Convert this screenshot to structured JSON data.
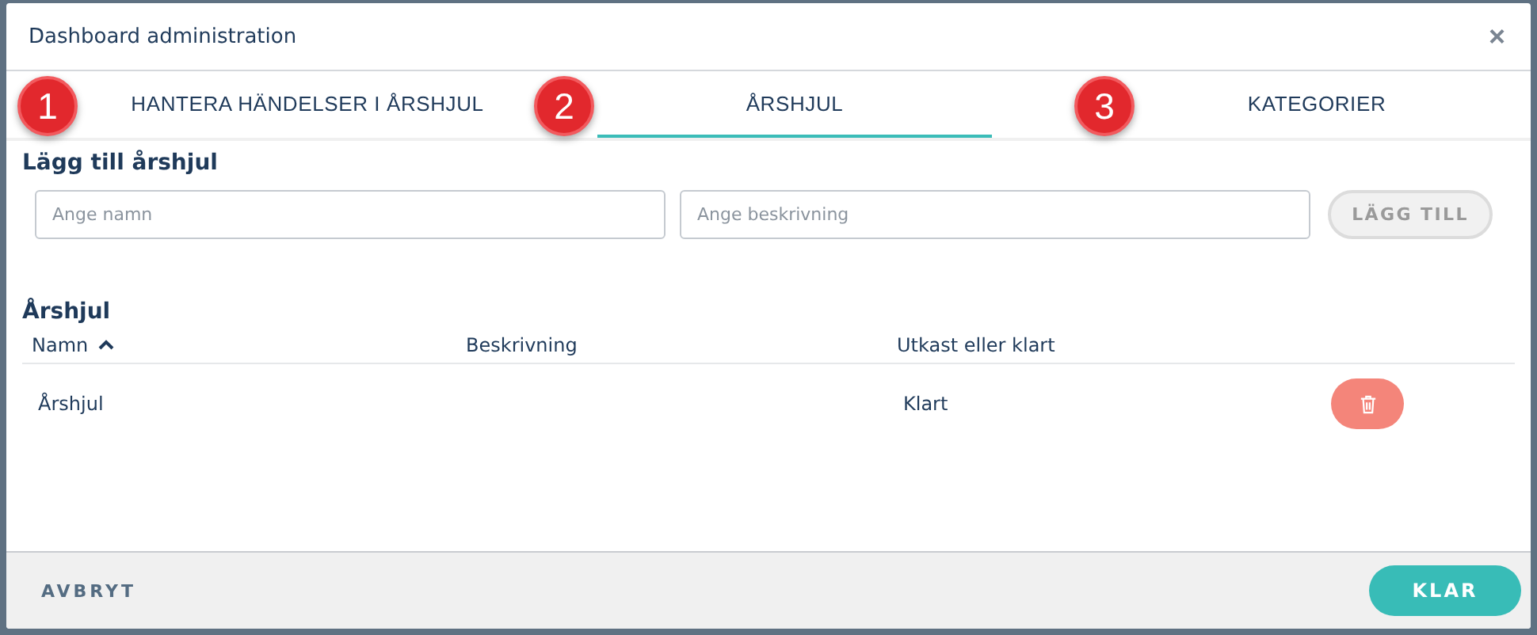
{
  "dialog": {
    "title": "Dashboard administration",
    "close_icon": "×"
  },
  "tabs": [
    {
      "label": "HANTERA HÄNDELSER I ÅRSHJUL",
      "step": "1",
      "selected": false
    },
    {
      "label": "ÅRSHJUL",
      "step": "2",
      "selected": true
    },
    {
      "label": "KATEGORIER",
      "step": "3",
      "selected": false
    }
  ],
  "add_form": {
    "heading": "Lägg till årshjul",
    "name_field": {
      "placeholder": "Ange namn"
    },
    "description_field": {
      "placeholder": "Ange beskrivning"
    },
    "add_button": {
      "label": "LÄGG TILL",
      "disabled": true
    }
  },
  "table": {
    "heading": "Årshjul",
    "columns": [
      {
        "label": "Namn",
        "sorted": true
      },
      {
        "label": "Beskrivning",
        "sorted": false
      },
      {
        "label": "Utkast eller klart",
        "sorted": false
      }
    ],
    "rows": [
      {
        "name": "Årshjul",
        "description_cell": "",
        "status": "Klart"
      }
    ]
  },
  "footer": {
    "cancel": "AVBRYT",
    "done": "KLAR"
  }
}
